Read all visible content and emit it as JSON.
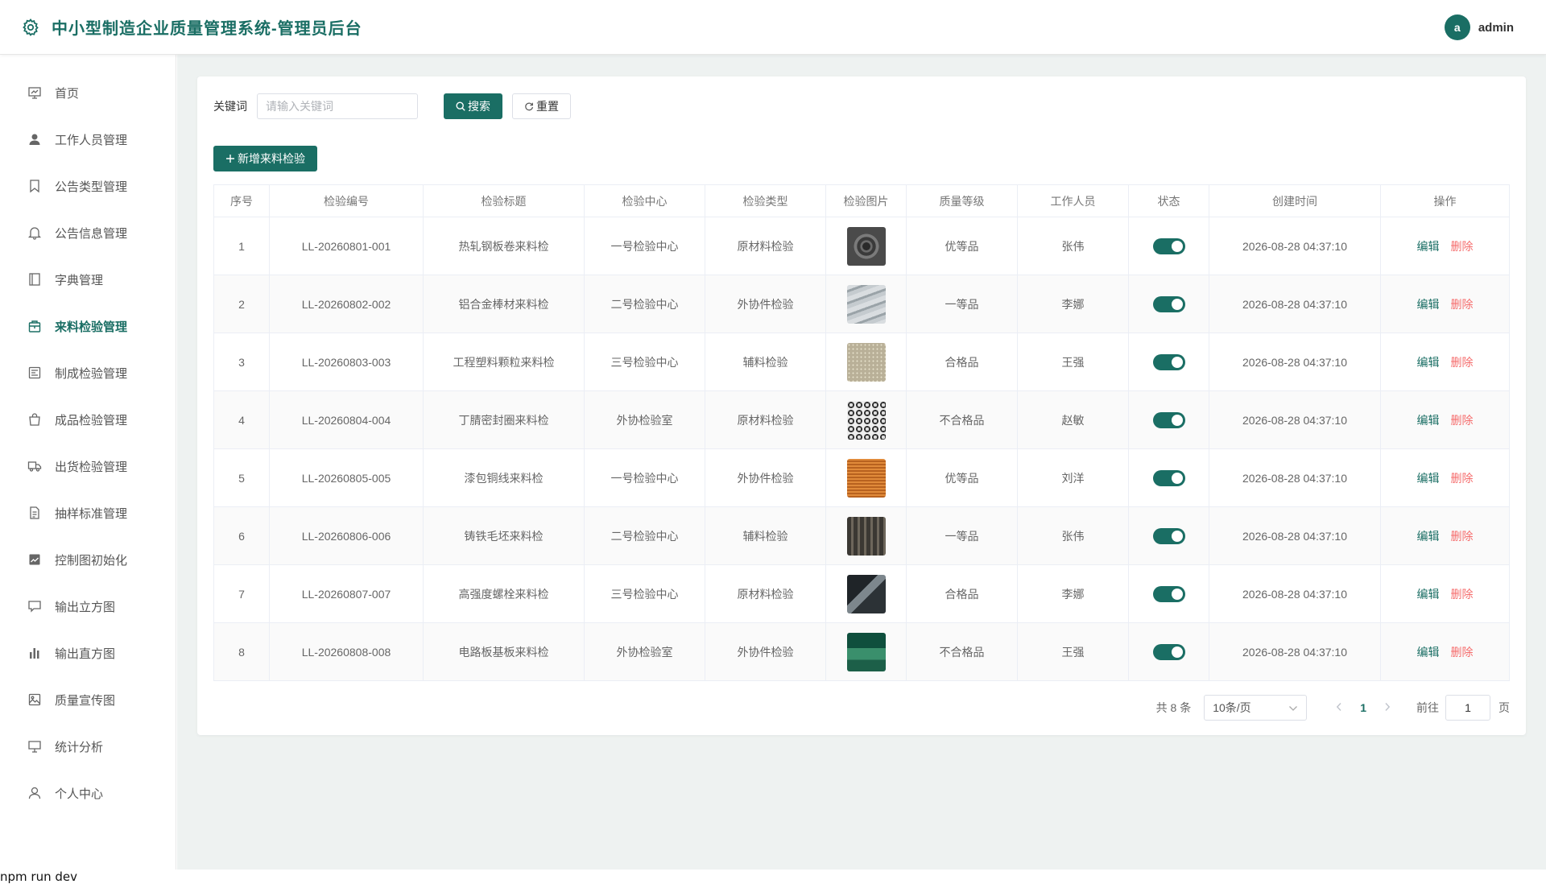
{
  "header": {
    "title": "中小型制造企业质量管理系统-管理员后台",
    "avatar_letter": "a",
    "username": "admin"
  },
  "sidebar": {
    "items": [
      {
        "label": "首页",
        "icon": "chart-board-icon",
        "active": false
      },
      {
        "label": "工作人员管理",
        "icon": "user-icon",
        "active": false
      },
      {
        "label": "公告类型管理",
        "icon": "bookmark-icon",
        "active": false
      },
      {
        "label": "公告信息管理",
        "icon": "bell-icon",
        "active": false
      },
      {
        "label": "字典管理",
        "icon": "book-icon",
        "active": false
      },
      {
        "label": "来料检验管理",
        "icon": "box-icon",
        "active": true
      },
      {
        "label": "制成检验管理",
        "icon": "document-list-icon",
        "active": false
      },
      {
        "label": "成品检验管理",
        "icon": "bag-icon",
        "active": false
      },
      {
        "label": "出货检验管理",
        "icon": "truck-icon",
        "active": false
      },
      {
        "label": "抽样标准管理",
        "icon": "file-text-icon",
        "active": false
      },
      {
        "label": "控制图初始化",
        "icon": "line-chart-icon",
        "active": false
      },
      {
        "label": "输出立方图",
        "icon": "chat-board-icon",
        "active": false
      },
      {
        "label": "输出直方图",
        "icon": "bar-chart-icon",
        "active": false
      },
      {
        "label": "质量宣传图",
        "icon": "picture-icon",
        "active": false
      },
      {
        "label": "统计分析",
        "icon": "presentation-icon",
        "active": false
      },
      {
        "label": "个人中心",
        "icon": "person-icon",
        "active": false
      }
    ]
  },
  "search": {
    "keyword_label": "关键词",
    "placeholder": "请输入关键词",
    "search_label": "搜索",
    "reset_label": "重置"
  },
  "toolbar": {
    "add_label": "新增来料检验"
  },
  "table": {
    "columns": [
      "序号",
      "检验编号",
      "检验标题",
      "检验中心",
      "检验类型",
      "检验图片",
      "质量等级",
      "工作人员",
      "状态",
      "创建时间",
      "操作"
    ],
    "edit_label": "编辑",
    "delete_label": "删除",
    "rows": [
      {
        "no": "1",
        "code": "LL-20260801-001",
        "title": "热轧钢板卷来料检",
        "center": "一号检验中心",
        "type": "原材料检验",
        "image": "steel-coil",
        "grade": "优等品",
        "staff": "张伟",
        "status": true,
        "created": "2026-08-28 04:37:10"
      },
      {
        "no": "2",
        "code": "LL-20260802-002",
        "title": "铝合金棒材来料检",
        "center": "二号检验中心",
        "type": "外协件检验",
        "image": "aluminum-bars",
        "grade": "一等品",
        "staff": "李娜",
        "status": true,
        "created": "2026-08-28 04:37:10"
      },
      {
        "no": "3",
        "code": "LL-20260803-003",
        "title": "工程塑料颗粒来料检",
        "center": "三号检验中心",
        "type": "辅料检验",
        "image": "plastic-pellets",
        "grade": "合格品",
        "staff": "王强",
        "status": true,
        "created": "2026-08-28 04:37:10"
      },
      {
        "no": "4",
        "code": "LL-20260804-004",
        "title": "丁腈密封圈来料检",
        "center": "外协检验室",
        "type": "原材料检验",
        "image": "seal-rings",
        "grade": "不合格品",
        "staff": "赵敏",
        "status": true,
        "created": "2026-08-28 04:37:10"
      },
      {
        "no": "5",
        "code": "LL-20260805-005",
        "title": "漆包铜线来料检",
        "center": "一号检验中心",
        "type": "外协件检验",
        "image": "copper-wire",
        "grade": "优等品",
        "staff": "刘洋",
        "status": true,
        "created": "2026-08-28 04:37:10"
      },
      {
        "no": "6",
        "code": "LL-20260806-006",
        "title": "铸铁毛坯来料检",
        "center": "二号检验中心",
        "type": "辅料检验",
        "image": "cast-iron",
        "grade": "一等品",
        "staff": "张伟",
        "status": true,
        "created": "2026-08-28 04:37:10"
      },
      {
        "no": "7",
        "code": "LL-20260807-007",
        "title": "高强度螺栓来料检",
        "center": "三号检验中心",
        "type": "原材料检验",
        "image": "bolts",
        "grade": "合格品",
        "staff": "李娜",
        "status": true,
        "created": "2026-08-28 04:37:10"
      },
      {
        "no": "8",
        "code": "LL-20260808-008",
        "title": "电路板基板来料检",
        "center": "外协检验室",
        "type": "外协件检验",
        "image": "circuit-board",
        "grade": "不合格品",
        "staff": "王强",
        "status": true,
        "created": "2026-08-28 04:37:10"
      }
    ]
  },
  "pager": {
    "total_text": "共 8 条",
    "page_size": "10条/页",
    "current_page": "1",
    "goto_label": "前往",
    "goto_value": "1",
    "goto_suffix": "页"
  },
  "terminal": {
    "text": "npm run dev"
  },
  "colors": {
    "primary": "#1a6e64",
    "danger": "#f56c6c",
    "background": "#eef2f1"
  }
}
